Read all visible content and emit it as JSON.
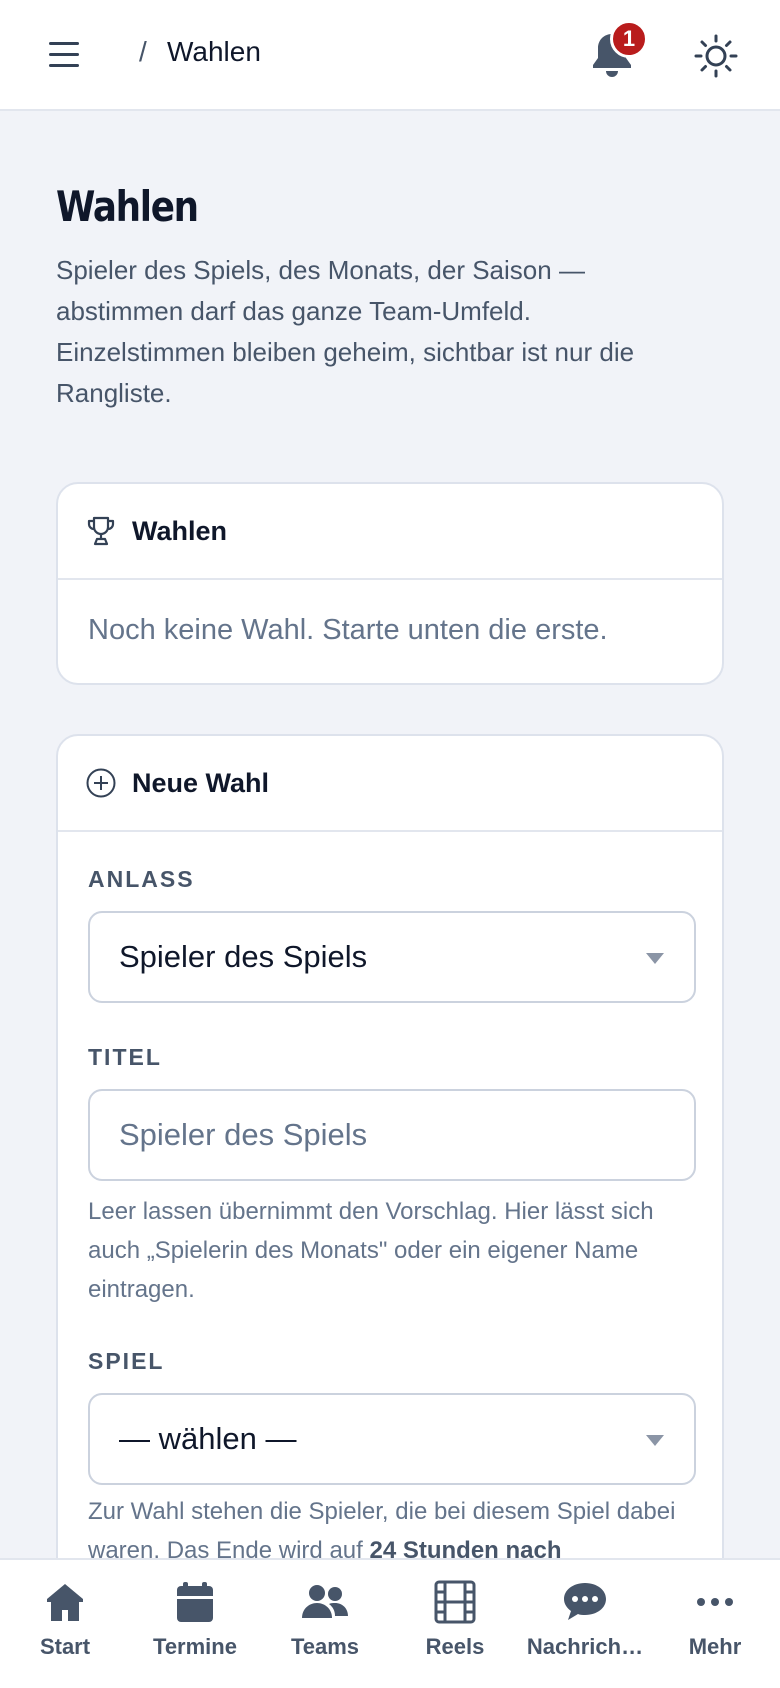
{
  "header": {
    "breadcrumb_sep": "/",
    "breadcrumb_title": "Wahlen",
    "notification_count": "1"
  },
  "intro": {
    "title": "Wahlen",
    "description": "Spieler des Spiels, des Monats, der Saison — abstimmen darf das ganze Team-Umfeld. Einzelstimmen bleiben geheim, sichtbar ist nur die Rangliste."
  },
  "polls_card": {
    "title": "Wahlen",
    "empty_text": "Noch keine Wahl. Starte unten die erste."
  },
  "new_poll": {
    "title": "Neue Wahl",
    "occasion_label": "ANLASS",
    "occasion_value": "Spieler des Spiels",
    "title_label": "TITEL",
    "title_placeholder": "Spieler des Spiels",
    "title_help": "Leer lassen übernimmt den Vorschlag. Hier lässt sich auch „Spielerin des Monats\" oder ein eigener Name eintragen.",
    "game_label": "SPIEL",
    "game_value": "— wählen —",
    "game_help_prefix": "Zur Wahl stehen die Spieler, die bei diesem Spiel dabei waren. Das Ende wird auf ",
    "game_help_bold": "24 Stunden nach"
  },
  "bottom_nav": [
    {
      "label": "Start",
      "icon": "home-icon"
    },
    {
      "label": "Termine",
      "icon": "calendar-icon"
    },
    {
      "label": "Teams",
      "icon": "users-icon"
    },
    {
      "label": "Reels",
      "icon": "film-icon"
    },
    {
      "label": "Nachrich…",
      "icon": "chat-icon"
    },
    {
      "label": "Mehr",
      "icon": "more-icon"
    }
  ],
  "colors": {
    "background": "#f1f3f8",
    "badge": "#b91c1c",
    "text_primary": "#0f172a",
    "text_muted": "#64748b",
    "nav_icon": "#475569"
  }
}
